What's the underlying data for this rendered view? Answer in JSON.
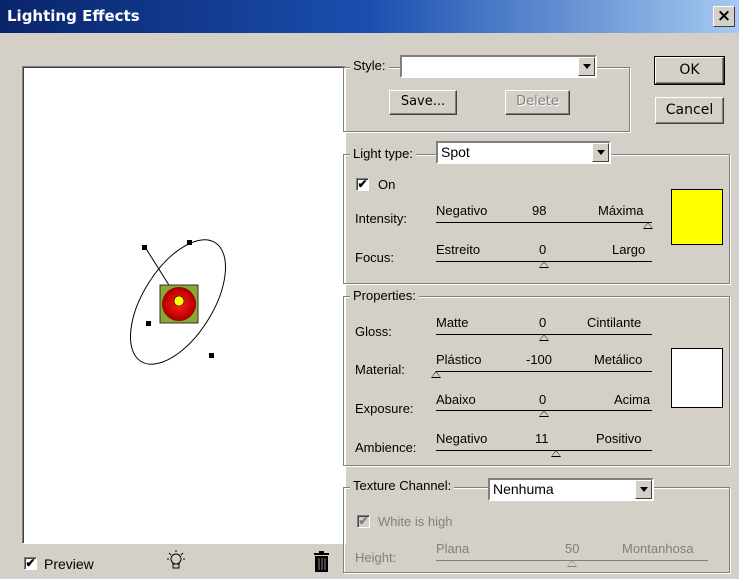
{
  "window": {
    "title": "Lighting Effects",
    "close": "×"
  },
  "preview": {
    "label": "Preview",
    "checked": "✔"
  },
  "style": {
    "label": "Style:",
    "value": "",
    "save": "Save...",
    "delete": "Delete"
  },
  "buttons": {
    "ok": "OK",
    "cancel": "Cancel"
  },
  "light_type": {
    "label": "Light type:",
    "value": "Spot",
    "on_label": "On",
    "on_checked": "✔",
    "color": "#ffff00",
    "intensity": {
      "label": "Intensity:",
      "min": "Negativo",
      "value": "98",
      "max": "Máxima",
      "pos": 0.98
    },
    "focus": {
      "label": "Focus:",
      "min": "Estreito",
      "value": "0",
      "max": "Largo",
      "pos": 0.5
    }
  },
  "properties": {
    "label": "Properties:",
    "color": "#ffffff",
    "gloss": {
      "label": "Gloss:",
      "min": "Matte",
      "value": "0",
      "max": "Cintilante",
      "pos": 0.5
    },
    "material": {
      "label": "Material:",
      "min": "Plástico",
      "value": "-100",
      "max": "Metálico",
      "pos": 0.0
    },
    "exposure": {
      "label": "Exposure:",
      "min": "Abaixo",
      "value": "0",
      "max": "Acima",
      "pos": 0.5
    },
    "ambience": {
      "label": "Ambience:",
      "min": "Negativo",
      "value": "11",
      "max": "Positivo",
      "pos": 0.555
    }
  },
  "texture": {
    "label": "Texture Channel:",
    "value": "Nenhuma",
    "white_is_high": "White is high",
    "white_checked": "✔",
    "height": {
      "label": "Height:",
      "min": "Plana",
      "value": "50",
      "max": "Montanhosa",
      "pos": 0.5
    }
  }
}
